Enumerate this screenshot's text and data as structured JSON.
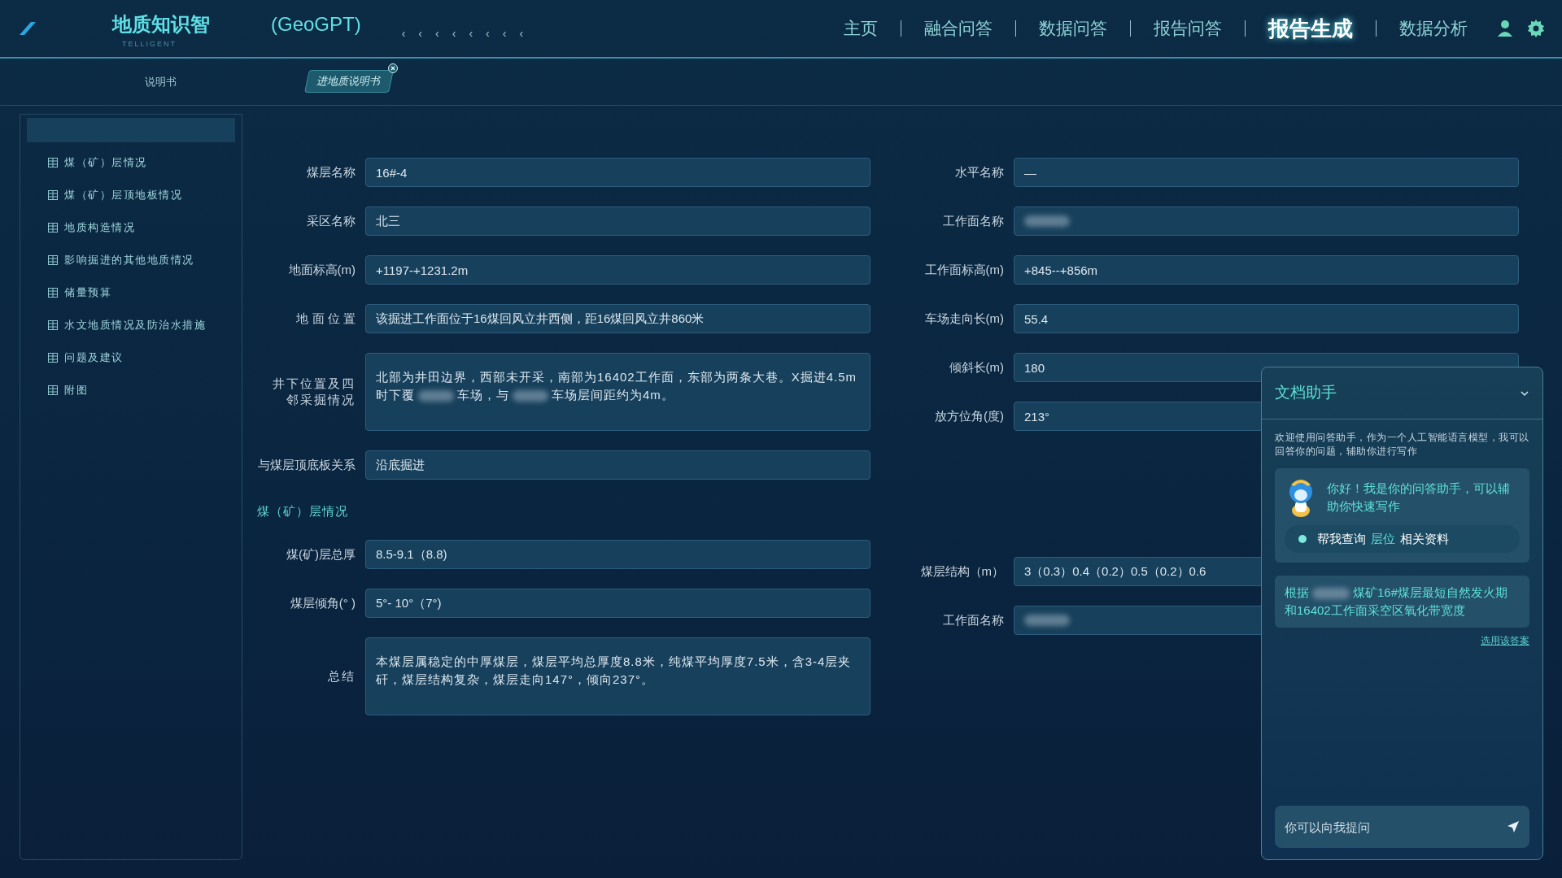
{
  "header": {
    "title_parts": [
      "地质知识智",
      "(GeoGPT)"
    ],
    "subtitle": "TELLIGENT",
    "chevrons": [
      "‹",
      "‹",
      "‹",
      "‹",
      "‹",
      "‹",
      "‹",
      "‹"
    ],
    "nav": [
      {
        "label": "主页",
        "selected": false
      },
      {
        "label": "融合问答",
        "selected": false
      },
      {
        "label": "数据问答",
        "selected": false
      },
      {
        "label": "报告问答",
        "selected": false
      },
      {
        "label": "报告生成",
        "selected": true
      },
      {
        "label": "数据分析",
        "selected": false
      }
    ]
  },
  "tabs": [
    {
      "label": "说明书",
      "selected": false,
      "closable": false
    },
    {
      "label": "进地质说明书",
      "selected": true,
      "closable": true
    }
  ],
  "sidebar": {
    "items": [
      {
        "selected": true
      },
      {
        "label": "煤（矿）层情况",
        "selected": false
      },
      {
        "label": "煤（矿）层顶地板情况",
        "selected": false
      },
      {
        "label": "地质构造情况",
        "selected": false
      },
      {
        "label": "影响掘进的其他地质情况",
        "selected": false
      },
      {
        "label": "储量预算",
        "selected": false
      },
      {
        "label": "水文地质情况及防治水措施",
        "selected": false
      },
      {
        "label": "问题及建议",
        "selected": false
      },
      {
        "label": "附图",
        "selected": false
      }
    ]
  },
  "form_left": [
    {
      "kind": "field",
      "label": "煤层名称",
      "value": "16#-4"
    },
    {
      "kind": "field",
      "label": "采区名称",
      "value": "北三"
    },
    {
      "kind": "field",
      "label": "地面标高(m)",
      "value": "+1197-+1231.2m"
    },
    {
      "kind": "field",
      "label": "地 面 位 置",
      "value": "该掘进工作面位于16煤回风立井西侧，距16煤回风立井860米"
    },
    {
      "kind": "area",
      "label": "井下位置及四邻采掘情况",
      "value_parts": [
        "北部为井田边界，西部未开采，南部为16402工作面，东部为两条大巷。X掘进4.5m时下覆",
        "车场，与",
        "车场层间距约为4m。"
      ]
    },
    {
      "kind": "field",
      "label": "与煤层顶底板关系",
      "value": "沿底掘进"
    },
    {
      "kind": "section",
      "label": "煤（矿）层情况"
    },
    {
      "kind": "field",
      "label": "煤(矿)层总厚",
      "value": "8.5-9.1（8.8)"
    },
    {
      "kind": "field",
      "label": "煤层倾角(°  )",
      "value": "5°- 10°（7°)"
    },
    {
      "kind": "area",
      "label": "总结",
      "value_parts": [
        "本煤层属稳定的中厚煤层，煤层平均总厚度8.8米，纯煤平均厚度7.5米，含3-4层夹矸，煤层结构复杂，煤层走向147°，倾向237°。"
      ]
    }
  ],
  "form_right": [
    {
      "kind": "field",
      "label": "水平名称",
      "value": "—"
    },
    {
      "kind": "blurred",
      "label": "工作面名称"
    },
    {
      "kind": "field",
      "label": "工作面标高(m)",
      "value": "+845--+856m"
    },
    {
      "kind": "field",
      "label": "车场走向长(m)",
      "value": "55.4"
    },
    {
      "kind": "field",
      "label": "倾斜长(m)",
      "value": "180"
    },
    {
      "kind": "field",
      "label": "放方位角(度)",
      "value": "213°"
    },
    {
      "kind": "gap"
    },
    {
      "kind": "field",
      "label": "煤层结构（m）",
      "value": "3（0.3）0.4（0.2）0.5（0.2）0.6"
    },
    {
      "kind": "blurred",
      "label": "工作面名称"
    }
  ],
  "assistant": {
    "title": "文档助手",
    "intro": "欢迎使用问答助手，作为一个人工智能语言模型，我可以回答你的问题，辅助你进行写作",
    "greeting": "你好！我是你的问答助手，可以辅助你快速写作",
    "suggestion": {
      "before": "帮我查询",
      "highlight": "层位",
      "after": "相关资料"
    },
    "answer_parts": [
      "根据",
      "煤矿16#煤层最短自然发火期和16402工作面采空区氧化带宽度"
    ],
    "use_answer": "选用该答案",
    "input_placeholder": "你可以向我提问"
  }
}
